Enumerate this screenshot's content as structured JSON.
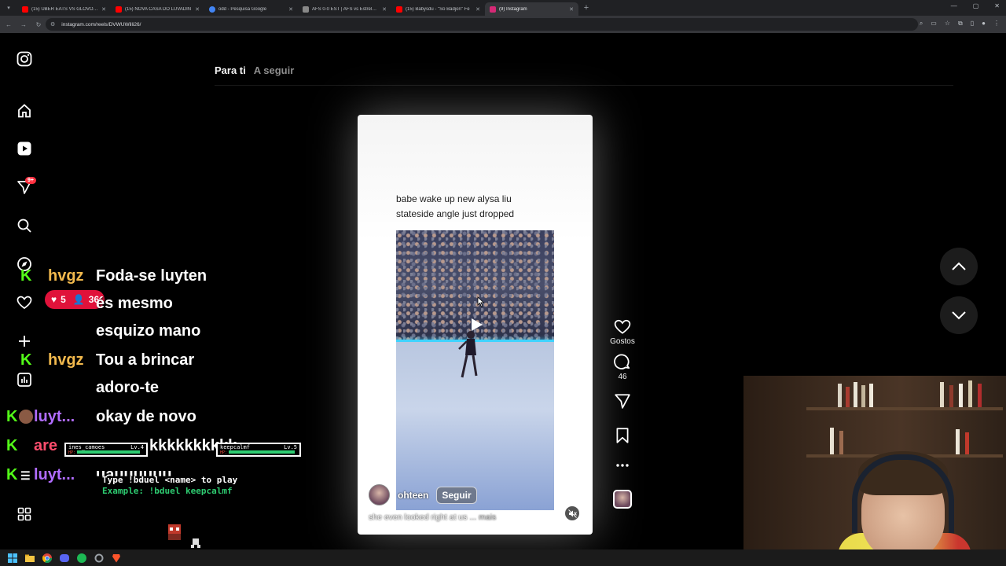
{
  "browser": {
    "tabs": [
      {
        "title": "(15) UBER EATS VS GLOVO | CI",
        "favicon_color": "#ff0000"
      },
      {
        "title": "(15) NOVA CASA DO LUVADIN",
        "favicon_color": "#ff0000"
      },
      {
        "title": "odd - Pesquisa Google",
        "favicon_color": "#4285f4"
      },
      {
        "title": "AFS 0-0 EST | AFS vs Estrela da",
        "favicon_color": "#888888"
      },
      {
        "title": "(15) Babysdu - \"So Badjon\" Fe",
        "favicon_color": "#ff0000"
      },
      {
        "title": "(9) Instagram",
        "favicon_color": "#d62976"
      }
    ],
    "url": "instagram.com/reels/DVWUWilli26/"
  },
  "instagram": {
    "notif_badge": "9+",
    "feed_tabs": {
      "active": "Para ti",
      "inactive": "A seguir"
    },
    "reel": {
      "caption_line1": "babe wake up new alysa liu",
      "caption_line2": "stateside angle just dropped",
      "author": "ohteen",
      "follow_label": "Seguir",
      "description": "she even looked right at us",
      "more_label": "... mais"
    },
    "actions": {
      "likes_label": "Gostos",
      "comments_count": "46"
    }
  },
  "overlay": {
    "viewers": {
      "likes": "5",
      "viewers": "36"
    },
    "chat": [
      {
        "user": "hvgz",
        "text": "Foda-se luyten",
        "user_color": "#f2b94d"
      },
      {
        "user": "",
        "text": "és mesmo",
        "user_color": ""
      },
      {
        "user": "",
        "text": "esquizo mano",
        "user_color": ""
      },
      {
        "user": "hvgz",
        "text": "Tou a brincar",
        "user_color": "#f2b94d"
      },
      {
        "user": "",
        "text": "adoro-te",
        "user_color": ""
      },
      {
        "user": "luyt...",
        "text": "okay de novo",
        "user_color": "#b06cff"
      },
      {
        "user": "are",
        "text": "kkkkkkkkkk",
        "user_color": "#ff4d6d"
      },
      {
        "user": "luyt...",
        "text": "uauuuuuu",
        "user_color": "#b06cff"
      }
    ],
    "duel": {
      "player1": "ines_camoes",
      "player1_level": "Lv.4",
      "player2": "keepcalmf",
      "player2_level": "Lv.5",
      "hp_label": "HP:",
      "line1": "Type !bduel <name> to play",
      "line2": "Example: !bduel keepcalmf"
    }
  }
}
